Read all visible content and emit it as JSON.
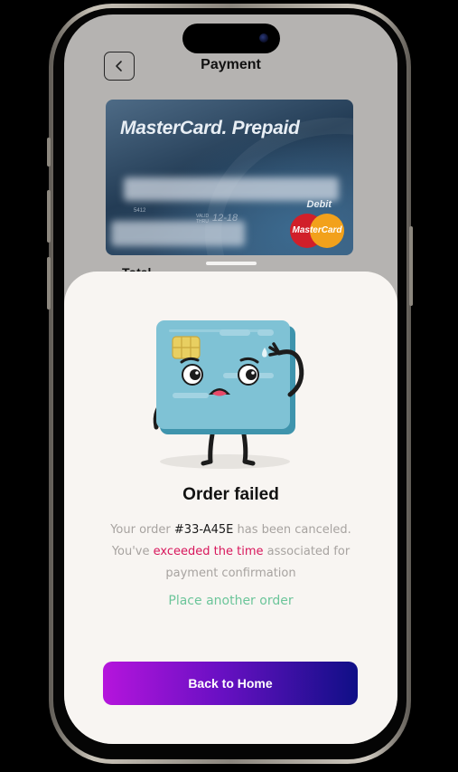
{
  "header": {
    "title": "Payment",
    "back_icon": "chevron-left-icon"
  },
  "card": {
    "brand": "MasterCard. Prepaid",
    "small_code": "5412",
    "valid_thru": "VALID THRU",
    "expiry": "12-18",
    "type": "Debit",
    "network_logo": "MasterCard"
  },
  "summary": {
    "total_label": "Total"
  },
  "sheet": {
    "illustration": "sad-credit-card-icon",
    "title": "Order failed",
    "line1_prefix": "Your order",
    "order_id": "#33-A45E",
    "line1_suffix": "has been canceled.",
    "line2_prefix": "You've",
    "line2_highlight": "exceeded the time",
    "line2_suffix": "associated for",
    "line3": "payment confirmation",
    "link": "Place another order",
    "button": "Back to Home"
  },
  "colors": {
    "error_highlight": "#d8175c",
    "link_green": "#6cc59a",
    "button_gradient_start": "#b515dc",
    "button_gradient_end": "#0f0f86",
    "sheet_background": "#f8f5f2"
  }
}
